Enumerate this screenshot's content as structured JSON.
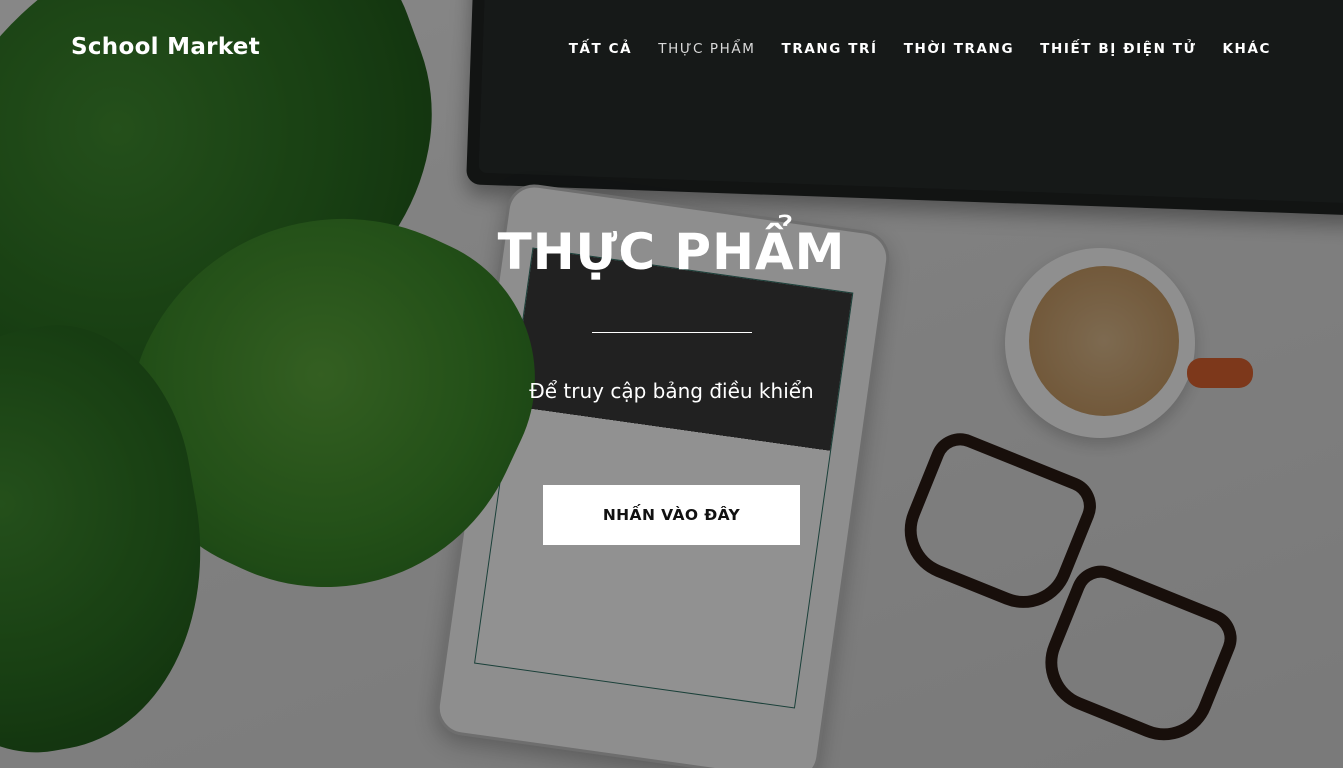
{
  "brand": {
    "name": "School Market"
  },
  "nav": {
    "items": [
      {
        "label": "TẤT CẢ",
        "active": false
      },
      {
        "label": "THỰC PHẨM",
        "active": true
      },
      {
        "label": "TRANG TRÍ",
        "active": false
      },
      {
        "label": "THỜI TRANG",
        "active": false
      },
      {
        "label": "THIẾT BỊ ĐIỆN TỬ",
        "active": false
      },
      {
        "label": "KHÁC",
        "active": false
      }
    ]
  },
  "hero": {
    "title": "THỰC PHẨM",
    "subtitle": "Để truy cập bảng điều khiển",
    "cta_label": "NHẤN VÀO ĐÂY"
  },
  "colors": {
    "text": "#ffffff",
    "button_bg": "#ffffff",
    "button_text": "#111111",
    "overlay": "rgba(0,0,0,0.42)"
  }
}
